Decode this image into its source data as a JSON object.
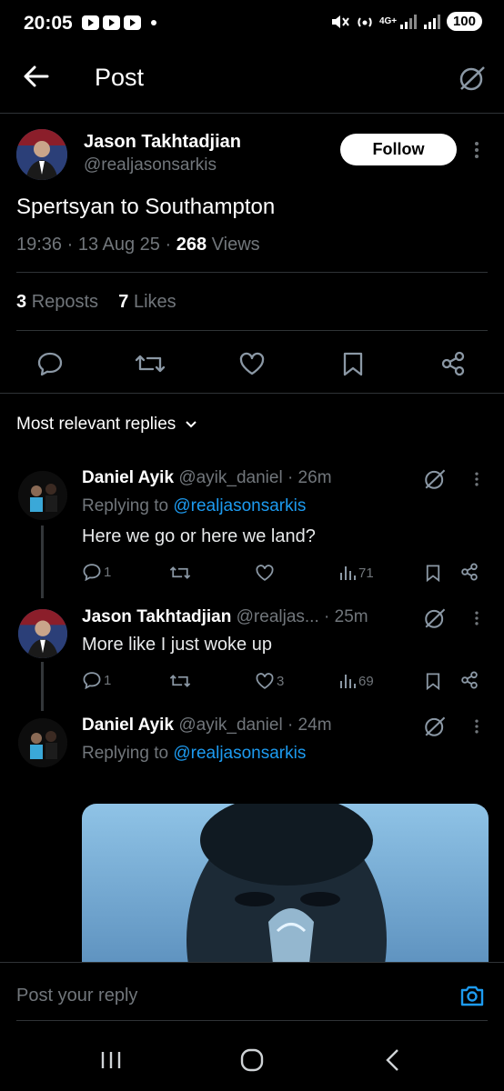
{
  "status_bar": {
    "time": "20:05",
    "battery": "100",
    "network": "4G+"
  },
  "header": {
    "title": "Post"
  },
  "post": {
    "author_name": "Jason Takhtadjian",
    "author_handle": "@realjasonsarkis",
    "follow_label": "Follow",
    "text": "Spertsyan to Southampton",
    "time": "19:36",
    "date": "13 Aug 25",
    "views_count": "268",
    "views_label": "Views",
    "reposts_count": "3",
    "reposts_label": "Reposts",
    "likes_count": "7",
    "likes_label": "Likes"
  },
  "replies_sort": {
    "label": "Most relevant replies"
  },
  "replies": [
    {
      "name": "Daniel Ayik",
      "handle": "@ayik_daniel",
      "time": "· 26m",
      "replying_prefix": "Replying to",
      "replying_to": "@realjasonsarkis",
      "text": "Here we go or here we land?",
      "replies": "1",
      "reposts": "",
      "likes": "",
      "views": "71"
    },
    {
      "name": "Jason Takhtadjian",
      "handle": "@realjas...",
      "time": "· 25m",
      "text": "More like I just woke up",
      "replies": "1",
      "reposts": "",
      "likes": "3",
      "views": "69"
    },
    {
      "name": "Daniel Ayik",
      "handle": "@ayik_daniel",
      "time": "· 24m",
      "replying_prefix": "Replying to",
      "replying_to": "@realjasonsarkis"
    }
  ],
  "compose": {
    "placeholder": "Post your reply"
  },
  "colors": {
    "background": "#000000",
    "accent": "#1d9bf0",
    "muted": "#71767b",
    "divider": "#2f3336"
  }
}
